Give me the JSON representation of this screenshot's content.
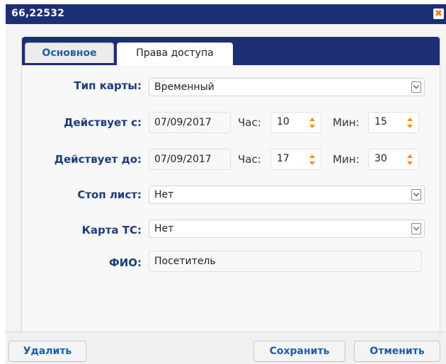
{
  "window": {
    "title": "66,22532"
  },
  "tabs": [
    {
      "label": "Основное"
    },
    {
      "label": "Права доступа"
    }
  ],
  "form": {
    "card_type": {
      "label": "Тип карты:",
      "value": "Временный"
    },
    "valid_from": {
      "label": "Действует с:",
      "date": "07/09/2017",
      "hour_label": "Час:",
      "hour": "10",
      "min_label": "Мин:",
      "min": "15"
    },
    "valid_to": {
      "label": "Действует до:",
      "date": "07/09/2017",
      "hour_label": "Час:",
      "hour": "17",
      "min_label": "Мин:",
      "min": "30"
    },
    "stop_list": {
      "label": "Стоп лист:",
      "value": "Нет"
    },
    "card_ts": {
      "label": "Карта ТС:",
      "value": "Нет"
    },
    "fio": {
      "label": "ФИО:",
      "value": "Посетитель"
    }
  },
  "buttons": {
    "delete": "Удалить",
    "save": "Сохранить",
    "cancel": "Отменить"
  },
  "colors": {
    "header": "#1c2f75",
    "accent": "#1c5fa8",
    "spinner_arrow": "#f29100",
    "close_icon": "#e67e00"
  },
  "icons": {
    "close": "close-icon",
    "dropdown": "chevron-down-icon",
    "spinner": "spinner-arrows-icon"
  }
}
